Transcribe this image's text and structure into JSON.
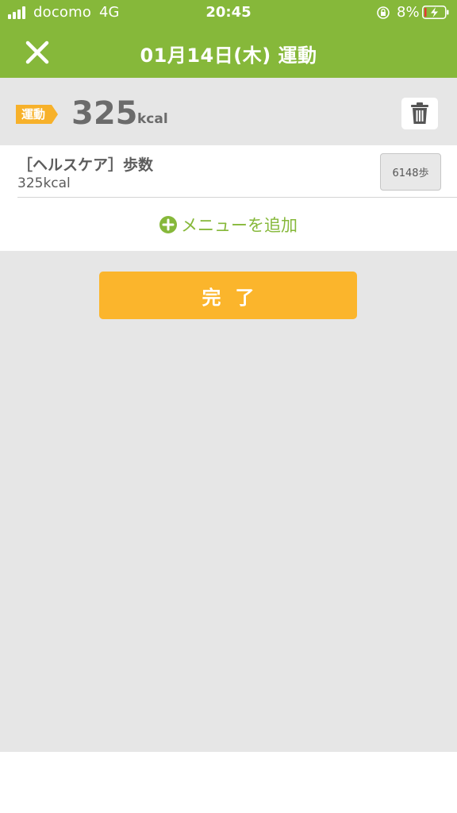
{
  "status_bar": {
    "carrier": "docomo",
    "network": "4G",
    "time": "20:45",
    "battery_percent": "8%"
  },
  "header": {
    "title": "01月14日(木) 運動",
    "close_icon": "close-icon",
    "background_color": "#86b83a"
  },
  "summary": {
    "category": "運動",
    "kcal_value": "325",
    "kcal_unit": "kcal",
    "delete_icon": "trash-icon"
  },
  "items": [
    {
      "name": "［ヘルスケア］歩数",
      "kcal": "325kcal",
      "steps": "6148歩"
    }
  ],
  "add_menu": {
    "label": "メニューを追加",
    "icon": "plus-circle-icon"
  },
  "done_button": {
    "label": "完了",
    "color": "#fbb52c"
  }
}
